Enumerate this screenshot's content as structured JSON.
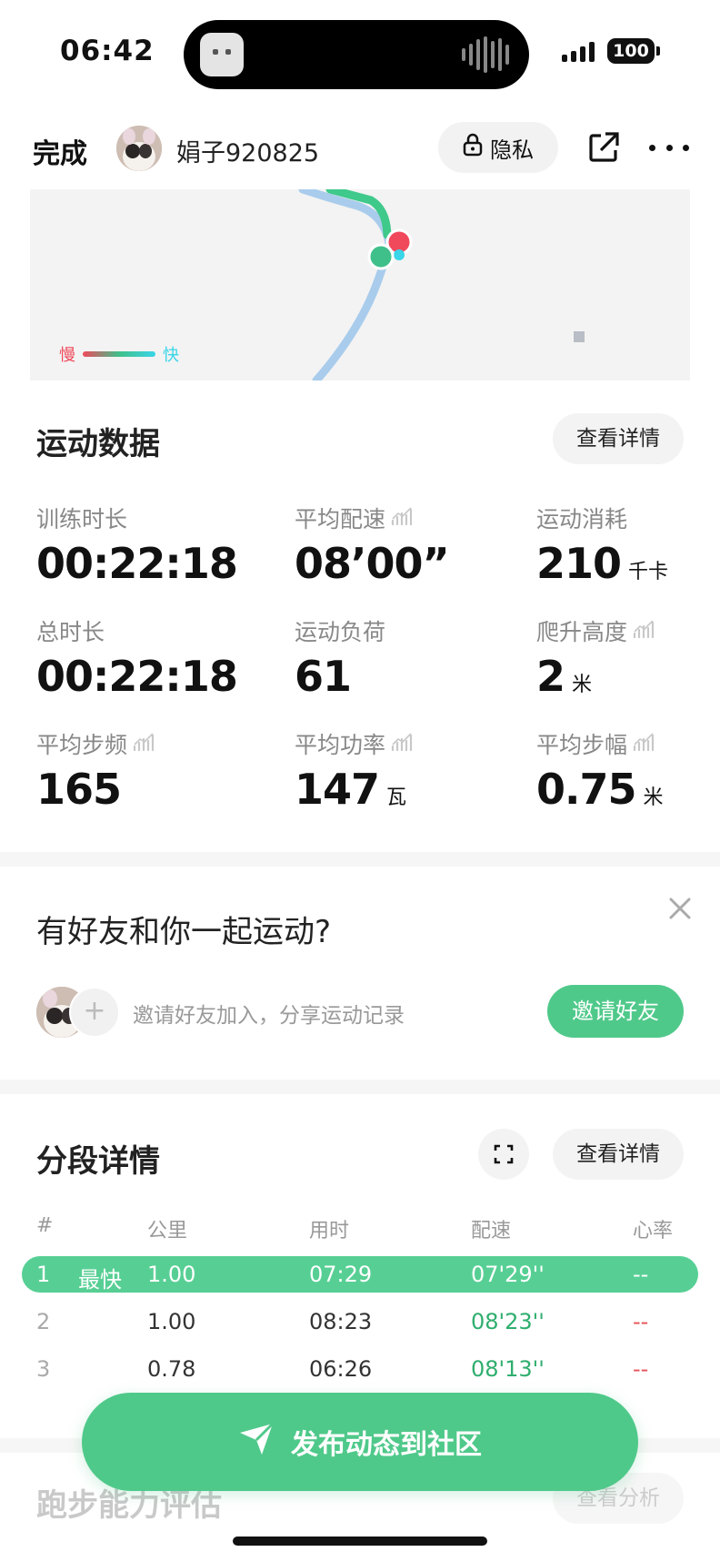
{
  "status_bar": {
    "time": "06:42",
    "battery": "100"
  },
  "nav": {
    "done_label": "完成",
    "username": "娟子920825",
    "privacy_label": "隐私"
  },
  "map": {
    "legend_slow": "慢",
    "legend_fast": "快"
  },
  "workout_data": {
    "title": "运动数据",
    "detail_label": "查看详情",
    "metrics": [
      {
        "label": "训练时长",
        "value": "00:22:18",
        "unit": "",
        "has_trend": false
      },
      {
        "label": "平均配速",
        "value": "08’00”",
        "unit": "",
        "has_trend": true
      },
      {
        "label": "运动消耗",
        "value": "210",
        "unit": "千卡",
        "has_trend": false
      },
      {
        "label": "总时长",
        "value": "00:22:18",
        "unit": "",
        "has_trend": false
      },
      {
        "label": "运动负荷",
        "value": "61",
        "unit": "",
        "has_trend": false
      },
      {
        "label": "爬升高度",
        "value": "2",
        "unit": "米",
        "has_trend": true
      },
      {
        "label": "平均步频",
        "value": "165",
        "unit": "",
        "has_trend": true
      },
      {
        "label": "平均功率",
        "value": "147",
        "unit": "瓦",
        "has_trend": true
      },
      {
        "label": "平均步幅",
        "value": "0.75",
        "unit": "米",
        "has_trend": true
      }
    ]
  },
  "friends": {
    "title": "有好友和你一起运动?",
    "invite_text": "邀请好友加入，分享运动记录",
    "invite_label": "邀请好友"
  },
  "segments": {
    "title": "分段详情",
    "detail_label": "查看详情",
    "headers": {
      "num": "#",
      "km": "公里",
      "time": "用时",
      "pace": "配速",
      "hr": "心率"
    },
    "best_label": "最快",
    "rows": [
      {
        "num": "1",
        "km": "1.00",
        "time": "07:29",
        "pace": "07'29''",
        "hr": "--",
        "best": true
      },
      {
        "num": "2",
        "km": "1.00",
        "time": "08:23",
        "pace": "08'23''",
        "hr": "--",
        "best": false
      },
      {
        "num": "3",
        "km": "0.78",
        "time": "06:26",
        "pace": "08'13''",
        "hr": "--",
        "best": false
      }
    ]
  },
  "running_ability": {
    "title": "跑步能力评估",
    "detail_label": "查看分析"
  },
  "publish": {
    "label": "发布动态到社区"
  },
  "colors": {
    "accent": "#4fc98a",
    "pace_green": "#2fae6e",
    "hr_red": "#e8525a"
  }
}
